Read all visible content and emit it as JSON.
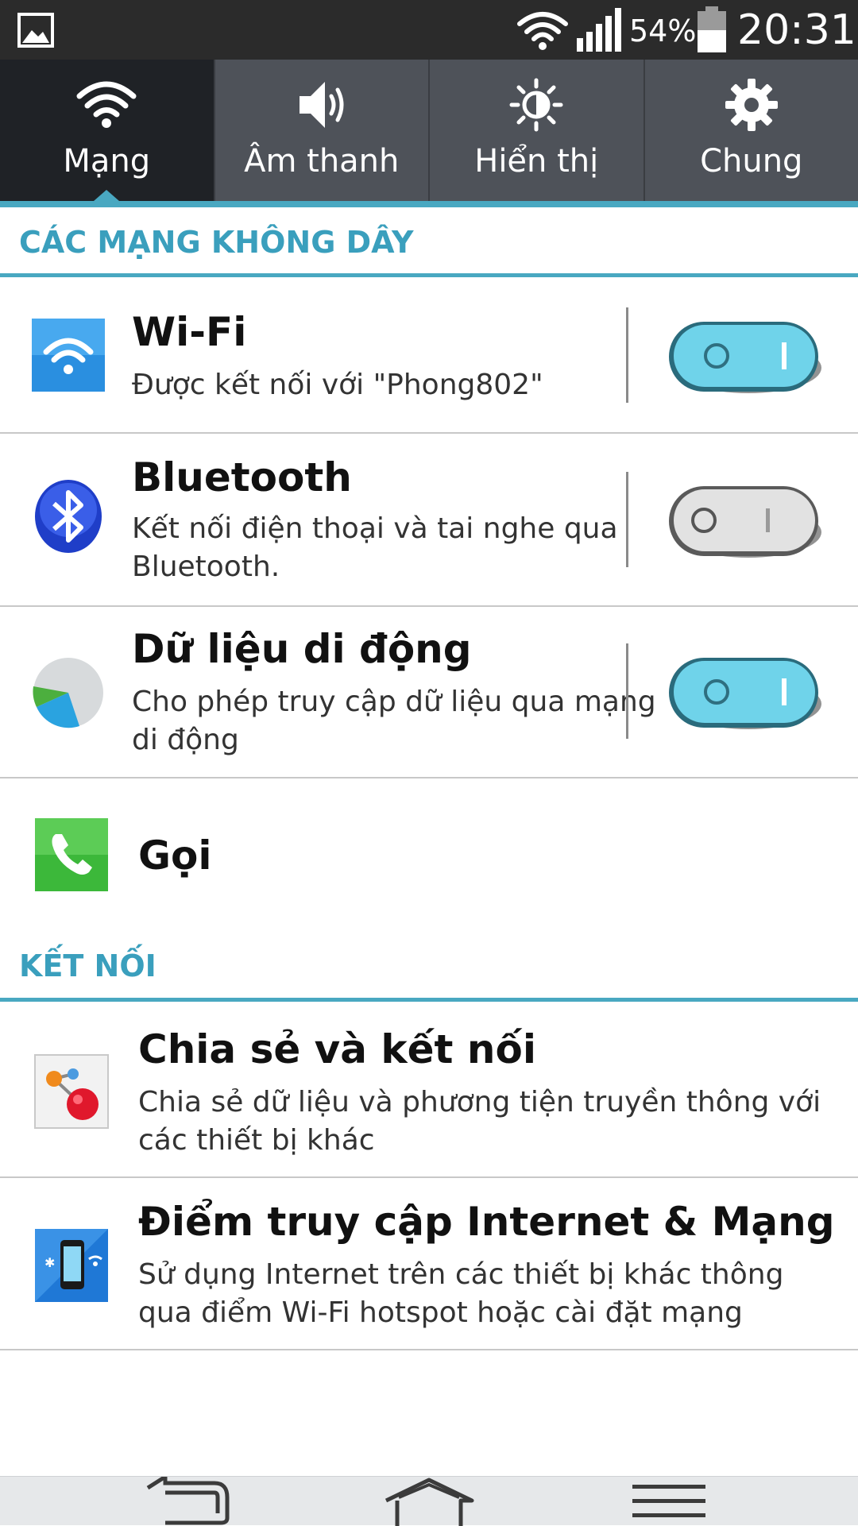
{
  "status_bar": {
    "battery_percent": "54%",
    "time": "20:31"
  },
  "tabs": [
    {
      "label": "Mạng",
      "icon": "wifi-icon",
      "active": true
    },
    {
      "label": "Âm thanh",
      "icon": "speaker-icon",
      "active": false
    },
    {
      "label": "Hiển thị",
      "icon": "brightness-icon",
      "active": false
    },
    {
      "label": "Chung",
      "icon": "gear-icon",
      "active": false
    }
  ],
  "sections": {
    "wireless": {
      "title": "CÁC MẠNG KHÔNG DÂY",
      "items": [
        {
          "title": "Wi-Fi",
          "subtitle": "Được kết nối với \"Phong802\"",
          "icon": "wifi-app-icon",
          "toggle": "on"
        },
        {
          "title": "Bluetooth",
          "subtitle": "Kết nối điện thoại và tai nghe qua Bluetooth.",
          "icon": "bluetooth-icon",
          "toggle": "off"
        },
        {
          "title": "Dữ liệu di động",
          "subtitle": "Cho phép truy cập dữ liệu qua mạng di động",
          "icon": "mobile-data-icon",
          "toggle": "on"
        },
        {
          "title": "Gọi",
          "icon": "phone-icon"
        }
      ]
    },
    "connect": {
      "title": "KẾT NỐI",
      "items": [
        {
          "title": "Chia sẻ và kết nối",
          "subtitle": "Chia sẻ dữ liệu và phương tiện truyền thông với các thiết bị khác",
          "icon": "share-connect-icon"
        },
        {
          "title": "Điểm truy cập Internet & Mạng",
          "subtitle": "Sử dụng Internet trên các thiết bị khác thông qua điểm Wi-Fi hotspot hoặc cài đặt mạng",
          "icon": "hotspot-icon"
        }
      ]
    }
  },
  "colors": {
    "accent": "#49a8c1",
    "tab_bg": "#4e5259",
    "tab_active_bg": "#1f2226",
    "toggle_on": "#6fd3ea",
    "toggle_off": "#e2e2e2"
  }
}
